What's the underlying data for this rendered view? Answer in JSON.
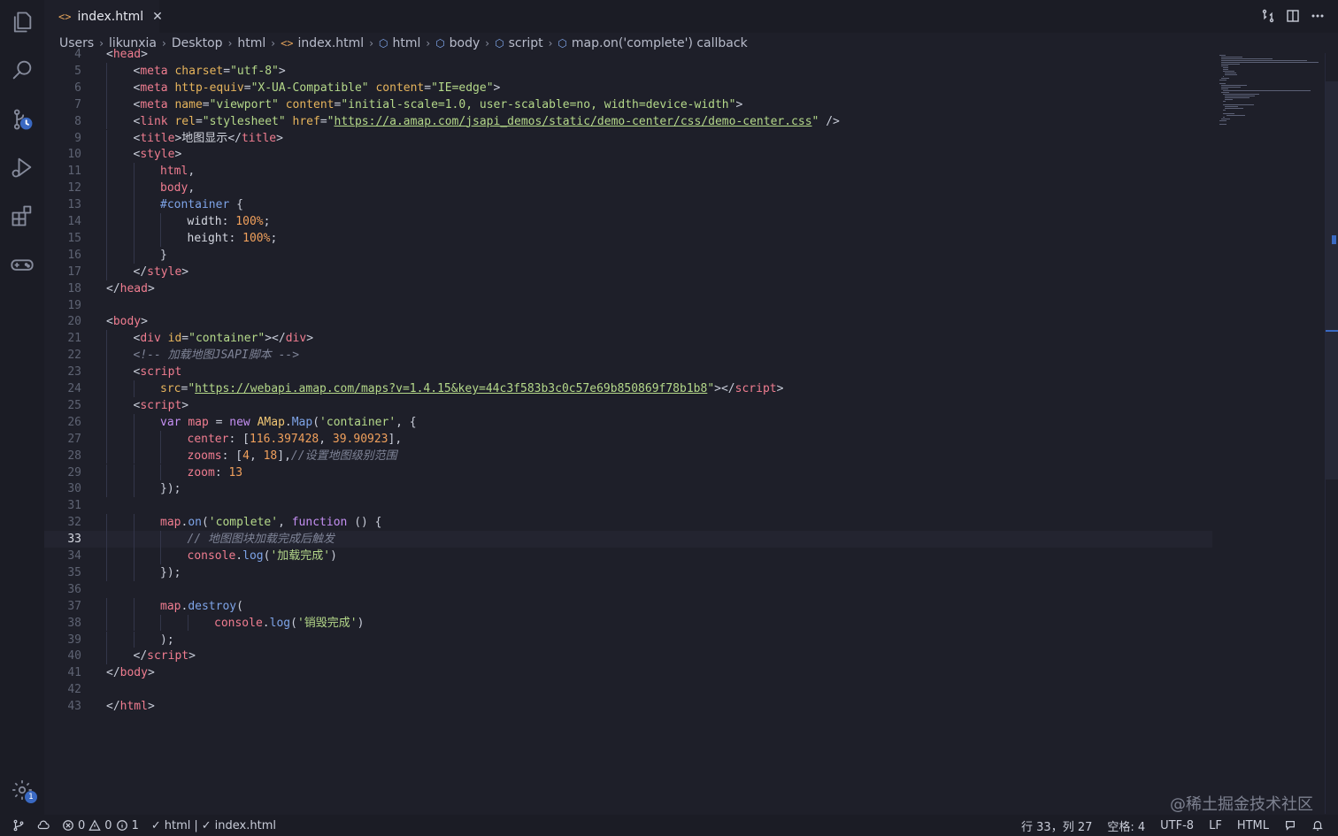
{
  "tab": {
    "filename": "index.html",
    "html_icon": "<>",
    "close_glyph": "✕"
  },
  "breadcrumb": [
    {
      "label": "Users",
      "icon": ""
    },
    {
      "label": "likunxia",
      "icon": ""
    },
    {
      "label": "Desktop",
      "icon": ""
    },
    {
      "label": "html",
      "icon": ""
    },
    {
      "label": "index.html",
      "icon": "html-file-icon"
    },
    {
      "label": "html",
      "icon": "cube-icon"
    },
    {
      "label": "body",
      "icon": "cube-icon"
    },
    {
      "label": "script",
      "icon": "cube-icon"
    },
    {
      "label": "map.on('complete') callback",
      "icon": "cube-icon"
    }
  ],
  "editor": {
    "active_line": 33,
    "lines": [
      {
        "n": "4",
        "indent": 1,
        "t": [
          [
            "t-punc",
            "<"
          ],
          [
            "t-tag",
            "head"
          ],
          [
            "t-punc",
            ">"
          ]
        ]
      },
      {
        "n": "5",
        "indent": 2,
        "t": [
          [
            "t-punc",
            "<"
          ],
          [
            "t-tag",
            "meta "
          ],
          [
            "t-attr",
            "charset"
          ],
          [
            "t-punc",
            "="
          ],
          [
            "t-str",
            "\"utf-8\""
          ],
          [
            "t-punc",
            ">"
          ]
        ]
      },
      {
        "n": "6",
        "indent": 2,
        "t": [
          [
            "t-punc",
            "<"
          ],
          [
            "t-tag",
            "meta "
          ],
          [
            "t-attr",
            "http-equiv"
          ],
          [
            "t-punc",
            "="
          ],
          [
            "t-str",
            "\"X-UA-Compatible\" "
          ],
          [
            "t-attr",
            "content"
          ],
          [
            "t-punc",
            "="
          ],
          [
            "t-str",
            "\"IE=edge\""
          ],
          [
            "t-punc",
            ">"
          ]
        ]
      },
      {
        "n": "7",
        "indent": 2,
        "t": [
          [
            "t-punc",
            "<"
          ],
          [
            "t-tag",
            "meta "
          ],
          [
            "t-attr",
            "name"
          ],
          [
            "t-punc",
            "="
          ],
          [
            "t-str",
            "\"viewport\" "
          ],
          [
            "t-attr",
            "content"
          ],
          [
            "t-punc",
            "="
          ],
          [
            "t-str",
            "\"initial-scale=1.0, user-scalable=no, width=device-width\""
          ],
          [
            "t-punc",
            ">"
          ]
        ]
      },
      {
        "n": "8",
        "indent": 2,
        "t": [
          [
            "t-punc",
            "<"
          ],
          [
            "t-tag",
            "link "
          ],
          [
            "t-attr",
            "rel"
          ],
          [
            "t-punc",
            "="
          ],
          [
            "t-str",
            "\"stylesheet\" "
          ],
          [
            "t-attr",
            "href"
          ],
          [
            "t-punc",
            "="
          ],
          [
            "t-str",
            "\""
          ],
          [
            "t-link",
            "https://a.amap.com/jsapi_demos/static/demo-center/css/demo-center.css"
          ],
          [
            "t-str",
            "\""
          ],
          [
            "t-punc",
            " />"
          ]
        ]
      },
      {
        "n": "9",
        "indent": 2,
        "t": [
          [
            "t-punc",
            "<"
          ],
          [
            "t-tag",
            "title"
          ],
          [
            "t-punc",
            ">"
          ],
          [
            "t-txt",
            "地图显示"
          ],
          [
            "t-punc",
            "</"
          ],
          [
            "t-tag",
            "title"
          ],
          [
            "t-punc",
            ">"
          ]
        ]
      },
      {
        "n": "10",
        "indent": 2,
        "t": [
          [
            "t-punc",
            "<"
          ],
          [
            "t-tag",
            "style"
          ],
          [
            "t-punc",
            ">"
          ]
        ]
      },
      {
        "n": "11",
        "indent": 3,
        "t": [
          [
            "t-var",
            "html"
          ],
          [
            "t-punc",
            ","
          ]
        ]
      },
      {
        "n": "12",
        "indent": 3,
        "t": [
          [
            "t-var",
            "body"
          ],
          [
            "t-punc",
            ","
          ]
        ]
      },
      {
        "n": "13",
        "indent": 3,
        "t": [
          [
            "t-sel",
            "#container"
          ],
          [
            "t-punc",
            " {"
          ]
        ]
      },
      {
        "n": "14",
        "indent": 4,
        "t": [
          [
            "t-txt",
            "width"
          ],
          [
            "t-punc",
            ": "
          ],
          [
            "t-num",
            "100%"
          ],
          [
            "t-punc",
            ";"
          ]
        ]
      },
      {
        "n": "15",
        "indent": 4,
        "t": [
          [
            "t-txt",
            "height"
          ],
          [
            "t-punc",
            ": "
          ],
          [
            "t-num",
            "100%"
          ],
          [
            "t-punc",
            ";"
          ]
        ]
      },
      {
        "n": "16",
        "indent": 3,
        "t": [
          [
            "t-punc",
            "}"
          ]
        ]
      },
      {
        "n": "17",
        "indent": 2,
        "t": [
          [
            "t-punc",
            "</"
          ],
          [
            "t-tag",
            "style"
          ],
          [
            "t-punc",
            ">"
          ]
        ]
      },
      {
        "n": "18",
        "indent": 1,
        "t": [
          [
            "t-punc",
            "</"
          ],
          [
            "t-tag",
            "head"
          ],
          [
            "t-punc",
            ">"
          ]
        ]
      },
      {
        "n": "19",
        "indent": 0,
        "t": []
      },
      {
        "n": "20",
        "indent": 1,
        "t": [
          [
            "t-punc",
            "<"
          ],
          [
            "t-tag",
            "body"
          ],
          [
            "t-punc",
            ">"
          ]
        ]
      },
      {
        "n": "21",
        "indent": 2,
        "t": [
          [
            "t-punc",
            "<"
          ],
          [
            "t-tag",
            "div "
          ],
          [
            "t-attr",
            "id"
          ],
          [
            "t-punc",
            "="
          ],
          [
            "t-str",
            "\"container\""
          ],
          [
            "t-punc",
            "></"
          ],
          [
            "t-tag",
            "div"
          ],
          [
            "t-punc",
            ">"
          ]
        ]
      },
      {
        "n": "22",
        "indent": 2,
        "t": [
          [
            "t-cm",
            "<!-- 加载地图JSAPI脚本 -->"
          ]
        ]
      },
      {
        "n": "23",
        "indent": 2,
        "t": [
          [
            "t-punc",
            "<"
          ],
          [
            "t-tag",
            "script"
          ]
        ]
      },
      {
        "n": "24",
        "indent": 3,
        "t": [
          [
            "t-attr",
            "src"
          ],
          [
            "t-punc",
            "="
          ],
          [
            "t-str",
            "\""
          ],
          [
            "t-link",
            "https://webapi.amap.com/maps?v=1.4.15&key=44c3f583b3c0c57e69b850869f78b1b8"
          ],
          [
            "t-str",
            "\""
          ],
          [
            "t-punc",
            "></"
          ],
          [
            "t-tag",
            "script"
          ],
          [
            "t-punc",
            ">"
          ]
        ]
      },
      {
        "n": "25",
        "indent": 2,
        "t": [
          [
            "t-punc",
            "<"
          ],
          [
            "t-tag",
            "script"
          ],
          [
            "t-punc",
            ">"
          ]
        ]
      },
      {
        "n": "26",
        "indent": 3,
        "t": [
          [
            "t-kw",
            "var "
          ],
          [
            "t-var",
            "map "
          ],
          [
            "t-punc",
            "= "
          ],
          [
            "t-kw",
            "new "
          ],
          [
            "t-cls",
            "AMap"
          ],
          [
            "t-punc",
            "."
          ],
          [
            "t-fn",
            "Map"
          ],
          [
            "t-punc",
            "("
          ],
          [
            "t-str",
            "'container'"
          ],
          [
            "t-punc",
            ", {"
          ]
        ]
      },
      {
        "n": "27",
        "indent": 4,
        "t": [
          [
            "t-var",
            "center"
          ],
          [
            "t-punc",
            ": ["
          ],
          [
            "t-num",
            "116.397428"
          ],
          [
            "t-punc",
            ", "
          ],
          [
            "t-num",
            "39.90923"
          ],
          [
            "t-punc",
            "],"
          ]
        ]
      },
      {
        "n": "28",
        "indent": 4,
        "t": [
          [
            "t-var",
            "zooms"
          ],
          [
            "t-punc",
            ": ["
          ],
          [
            "t-num",
            "4"
          ],
          [
            "t-punc",
            ", "
          ],
          [
            "t-num",
            "18"
          ],
          [
            "t-punc",
            "],"
          ],
          [
            "t-cm",
            "//设置地图级别范围"
          ]
        ]
      },
      {
        "n": "29",
        "indent": 4,
        "t": [
          [
            "t-var",
            "zoom"
          ],
          [
            "t-punc",
            ": "
          ],
          [
            "t-num",
            "13"
          ]
        ]
      },
      {
        "n": "30",
        "indent": 3,
        "t": [
          [
            "t-punc",
            "});"
          ]
        ]
      },
      {
        "n": "31",
        "indent": 0,
        "t": []
      },
      {
        "n": "32",
        "indent": 3,
        "t": [
          [
            "t-var",
            "map"
          ],
          [
            "t-punc",
            "."
          ],
          [
            "t-fn",
            "on"
          ],
          [
            "t-punc",
            "("
          ],
          [
            "t-str",
            "'complete'"
          ],
          [
            "t-punc",
            ", "
          ],
          [
            "t-kw",
            "function "
          ],
          [
            "t-punc",
            "() {"
          ]
        ]
      },
      {
        "n": "33",
        "indent": 4,
        "t": [
          [
            "t-cm",
            "// 地图图块加载完成后触发"
          ]
        ]
      },
      {
        "n": "34",
        "indent": 4,
        "t": [
          [
            "t-var",
            "console"
          ],
          [
            "t-punc",
            "."
          ],
          [
            "t-fn",
            "log"
          ],
          [
            "t-punc",
            "("
          ],
          [
            "t-str",
            "'加载完成'"
          ],
          [
            "t-punc",
            ")"
          ]
        ]
      },
      {
        "n": "35",
        "indent": 3,
        "t": [
          [
            "t-punc",
            "});"
          ]
        ]
      },
      {
        "n": "36",
        "indent": 0,
        "t": []
      },
      {
        "n": "37",
        "indent": 3,
        "t": [
          [
            "t-var",
            "map"
          ],
          [
            "t-punc",
            "."
          ],
          [
            "t-fn",
            "destroy"
          ],
          [
            "t-punc",
            "("
          ]
        ]
      },
      {
        "n": "38",
        "indent": 5,
        "t": [
          [
            "t-var",
            "console"
          ],
          [
            "t-punc",
            "."
          ],
          [
            "t-fn",
            "log"
          ],
          [
            "t-punc",
            "("
          ],
          [
            "t-str",
            "'销毁完成'"
          ],
          [
            "t-punc",
            ")"
          ]
        ]
      },
      {
        "n": "39",
        "indent": 3,
        "t": [
          [
            "t-punc",
            ");"
          ]
        ]
      },
      {
        "n": "40",
        "indent": 2,
        "t": [
          [
            "t-punc",
            "</"
          ],
          [
            "t-tag",
            "script"
          ],
          [
            "t-punc",
            ">"
          ]
        ]
      },
      {
        "n": "41",
        "indent": 1,
        "t": [
          [
            "t-punc",
            "</"
          ],
          [
            "t-tag",
            "body"
          ],
          [
            "t-punc",
            ">"
          ]
        ]
      },
      {
        "n": "42",
        "indent": 0,
        "t": []
      },
      {
        "n": "43",
        "indent": 1,
        "t": [
          [
            "t-punc",
            "</"
          ],
          [
            "t-tag",
            "html"
          ],
          [
            "t-punc",
            ">"
          ]
        ]
      }
    ]
  },
  "activity_bar": [
    "explorer-icon",
    "search-icon",
    "source-control-icon",
    "run-debug-icon",
    "extensions-icon",
    "gamepad-icon"
  ],
  "settings_badge": "1",
  "status": {
    "errors": "0",
    "warnings": "0",
    "info": "1",
    "check_1": "html",
    "divider": "|",
    "check_2": "index.html",
    "position": "行 33，列 27",
    "spaces": "空格: 4",
    "encoding": "UTF-8",
    "eol": "LF",
    "language": "HTML"
  },
  "watermark": "@稀土掘金技术社区",
  "colors": {
    "background": "#1e1f29",
    "accent": "#3a69c2",
    "tag": "#f07d90",
    "string": "#b5d98a"
  }
}
